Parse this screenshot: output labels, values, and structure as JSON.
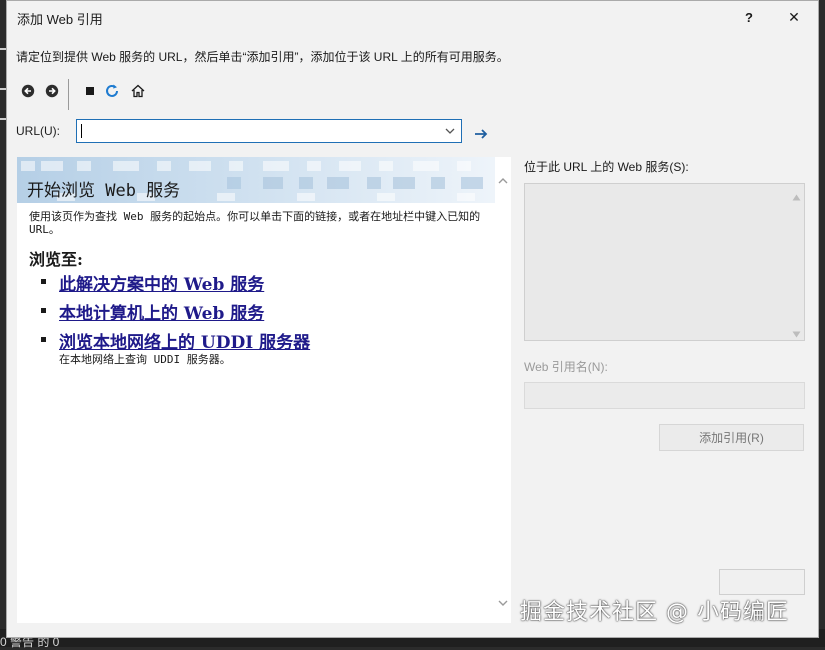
{
  "window": {
    "title": "添加 Web 引用",
    "help_label": "?",
    "close_label": "✕"
  },
  "instruction": "请定位到提供 Web 服务的 URL，然后单击“添加引用”，添加位于该 URL 上的所有可用服务。",
  "toolbar": {
    "icons": [
      "back-icon",
      "forward-icon",
      "stop-icon",
      "refresh-icon",
      "home-icon"
    ]
  },
  "url": {
    "label": "URL(U):",
    "value": "",
    "go_icon": "arrow-right-icon"
  },
  "browser": {
    "banner_title": "开始浏览 Web 服务",
    "intro": "使用该页作为查找 Web 服务的起始点。你可以单击下面的链接，或者在地址栏中键入已知的 URL。",
    "browse_heading": "浏览至:",
    "links": [
      {
        "label": "此解决方案中的 Web 服务"
      },
      {
        "label": "本地计算机上的 Web 服务"
      },
      {
        "label": "浏览本地网络上的 UDDI 服务器",
        "desc": "在本地网络上查询 UDDI 服务器。"
      }
    ]
  },
  "services": {
    "label": "位于此 URL 上的 Web 服务(S):"
  },
  "reference": {
    "label": "Web 引用名(N):",
    "value": ""
  },
  "buttons": {
    "add_reference": "添加引用(R)"
  },
  "background": {
    "status_text": "0 警告 的 0"
  },
  "watermark": "掘金技术社区 @ 小码编匠",
  "colors": {
    "accent": "#1f6fb5",
    "link": "#1f1a8a",
    "refresh": "#1e7bd0"
  }
}
